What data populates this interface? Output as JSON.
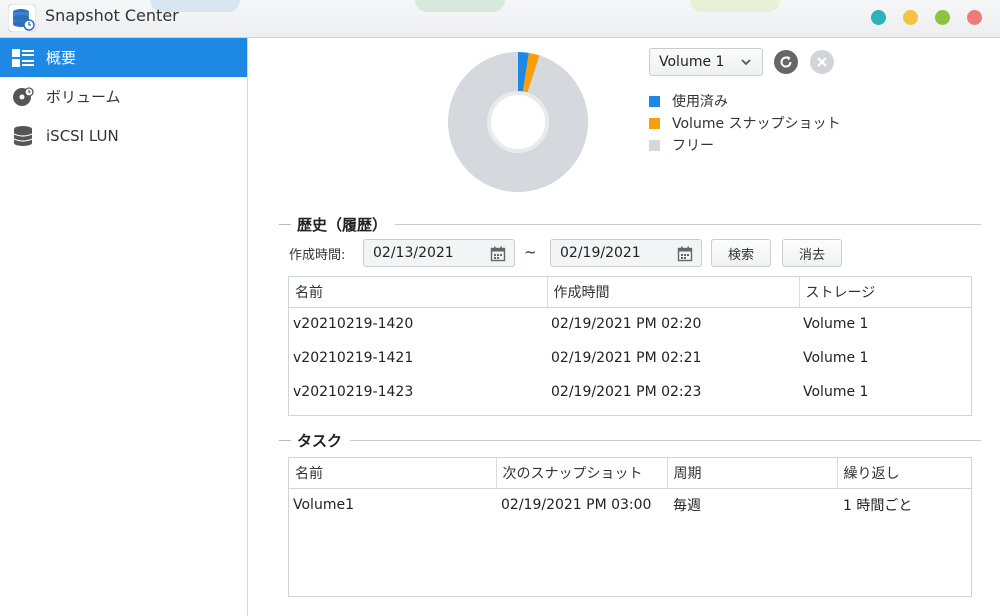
{
  "app": {
    "title": "Snapshot Center"
  },
  "window_buttons": [
    {
      "name": "teal",
      "color": "#2bb3b8"
    },
    {
      "name": "yellow",
      "color": "#f5c340"
    },
    {
      "name": "green",
      "color": "#8cc43f"
    },
    {
      "name": "red",
      "color": "#f07a7a"
    }
  ],
  "sidebar": {
    "items": [
      {
        "label": "概要",
        "icon": "overview-icon",
        "active": true
      },
      {
        "label": "ボリューム",
        "icon": "volume-icon",
        "active": false
      },
      {
        "label": "iSCSI LUN",
        "icon": "database-icon",
        "active": false
      }
    ]
  },
  "overview": {
    "volume_select": "Volume 1",
    "legend": [
      {
        "label": "使用済み",
        "color": "#1e88e5"
      },
      {
        "label": "Volume スナップショット",
        "color": "#f5a00a"
      },
      {
        "label": "フリー",
        "color": "#d5d8dd"
      }
    ],
    "usage": {
      "used": 0.025,
      "snapshot": 0.025,
      "free": 0.95
    }
  },
  "history": {
    "title": "歴史（履歴）",
    "filter_label": "作成時間:",
    "from_date": "02/13/2021",
    "separator": "~",
    "to_date": "02/19/2021",
    "search_label": "検索",
    "clear_label": "消去",
    "columns": [
      "名前",
      "作成時間",
      "ストレージ"
    ],
    "rows": [
      [
        "v20210219-1420",
        "02/19/2021 PM 02:20",
        "Volume 1"
      ],
      [
        "v20210219-1421",
        "02/19/2021 PM 02:21",
        "Volume 1"
      ],
      [
        "v20210219-1423",
        "02/19/2021 PM 02:23",
        "Volume 1"
      ]
    ]
  },
  "tasks": {
    "title": "タスク",
    "columns": [
      "名前",
      "次のスナップショット",
      "周期",
      "繰り返し"
    ],
    "rows": [
      [
        "Volume1",
        "02/19/2021 PM 03:00",
        "毎週",
        "1 時間ごと"
      ]
    ]
  }
}
